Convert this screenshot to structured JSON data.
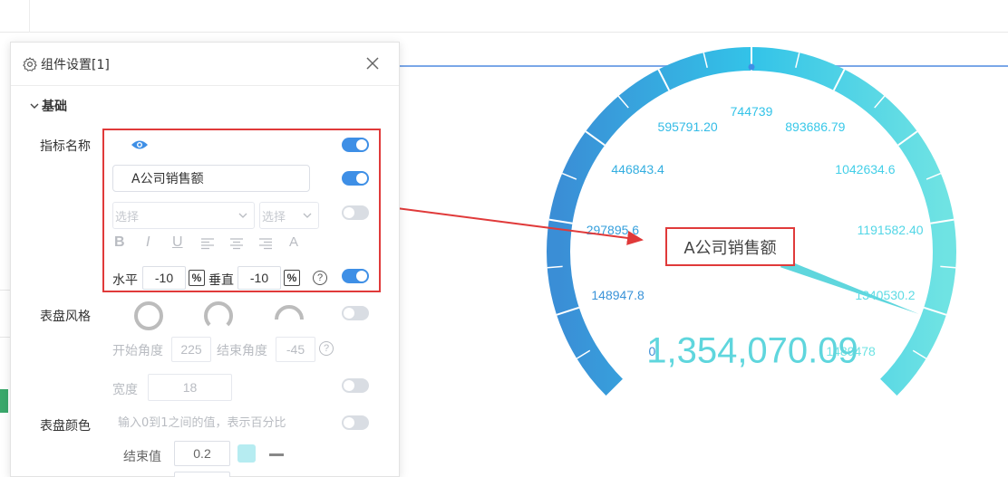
{
  "panel": {
    "title": "组件设置[1]",
    "section_basic": "基础",
    "indicator_name_label": "指标名称",
    "name_value": "A公司销售额",
    "font_select_placeholder": "选择",
    "size_select_placeholder": "选择",
    "format_bold": "B",
    "format_italic": "I",
    "format_underline": "U",
    "format_font_color": "A",
    "horizontal_label": "水平",
    "horizontal_value": "-10",
    "vertical_label": "垂直",
    "vertical_value": "-10",
    "percent_symbol": "%",
    "help_symbol": "?",
    "dial_style_label": "表盘风格",
    "start_angle_label": "开始角度",
    "start_angle_value": "225",
    "end_angle_label": "结束角度",
    "end_angle_value": "-45",
    "width_label": "宽度",
    "width_value": "18",
    "dial_color_label": "表盘颜色",
    "dial_color_hint": "输入0到1之间的值，表示百分比",
    "end_value_label": "结束值",
    "end_value": "0.2",
    "end_color": "#b6ecf1",
    "switches": {
      "show_name": true,
      "name_text": true,
      "font": false,
      "offset": true,
      "dial_style": false,
      "width": false,
      "dial_color": false
    }
  },
  "gauge": {
    "title": "A公司销售额",
    "value_display": "1,354,070.09",
    "start_angle": 225,
    "end_angle": -45,
    "gradient_start": "#3a8ed6",
    "gradient_mid": "#33c3e8",
    "gradient_end": "#6fe3e3"
  },
  "chart_data": {
    "type": "gauge",
    "min": 0,
    "max": 1489478,
    "value": 1354070.09,
    "tick_labels": [
      "0",
      "148947.8",
      "297895.6",
      "446843.4",
      "595791.20",
      "744739",
      "893686.79",
      "1042634.6",
      "1191582.40",
      "1340530.2",
      "1489478"
    ],
    "title": "A公司销售额"
  }
}
